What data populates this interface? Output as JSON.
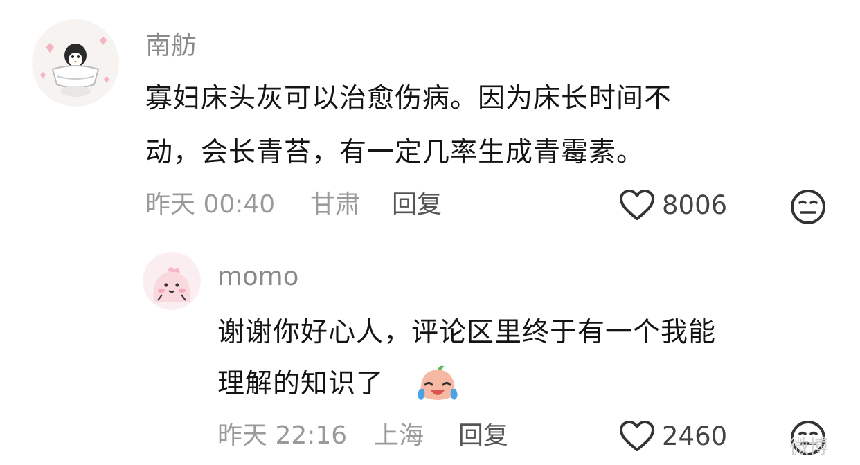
{
  "comment": {
    "author": "南舫",
    "text_line1": "寡妇床头灰可以治愈伤病。因为床长时间不",
    "text_line2": "动，会长青苔，有一定几率生成青霉素。",
    "time": "昨天 00:40",
    "location": "甘肃",
    "reply_label": "回复",
    "likes": "8006",
    "avatar_icon": "penguin-avatar-icon"
  },
  "reply": {
    "author": "momo",
    "text_line1": "谢谢你好心人，评论区里终于有一个我能",
    "text_line2": "理解的知识了",
    "emoji": "crying-laughing-peach-emoji",
    "time": "昨天 22:16",
    "location": "上海",
    "reply_label": "回复",
    "likes": "2460",
    "avatar_icon": "pink-blob-avatar-icon"
  },
  "watermark": "微博",
  "colors": {
    "text": "#141414",
    "meta": "#9a9a9a",
    "name": "#8a8a8a"
  }
}
